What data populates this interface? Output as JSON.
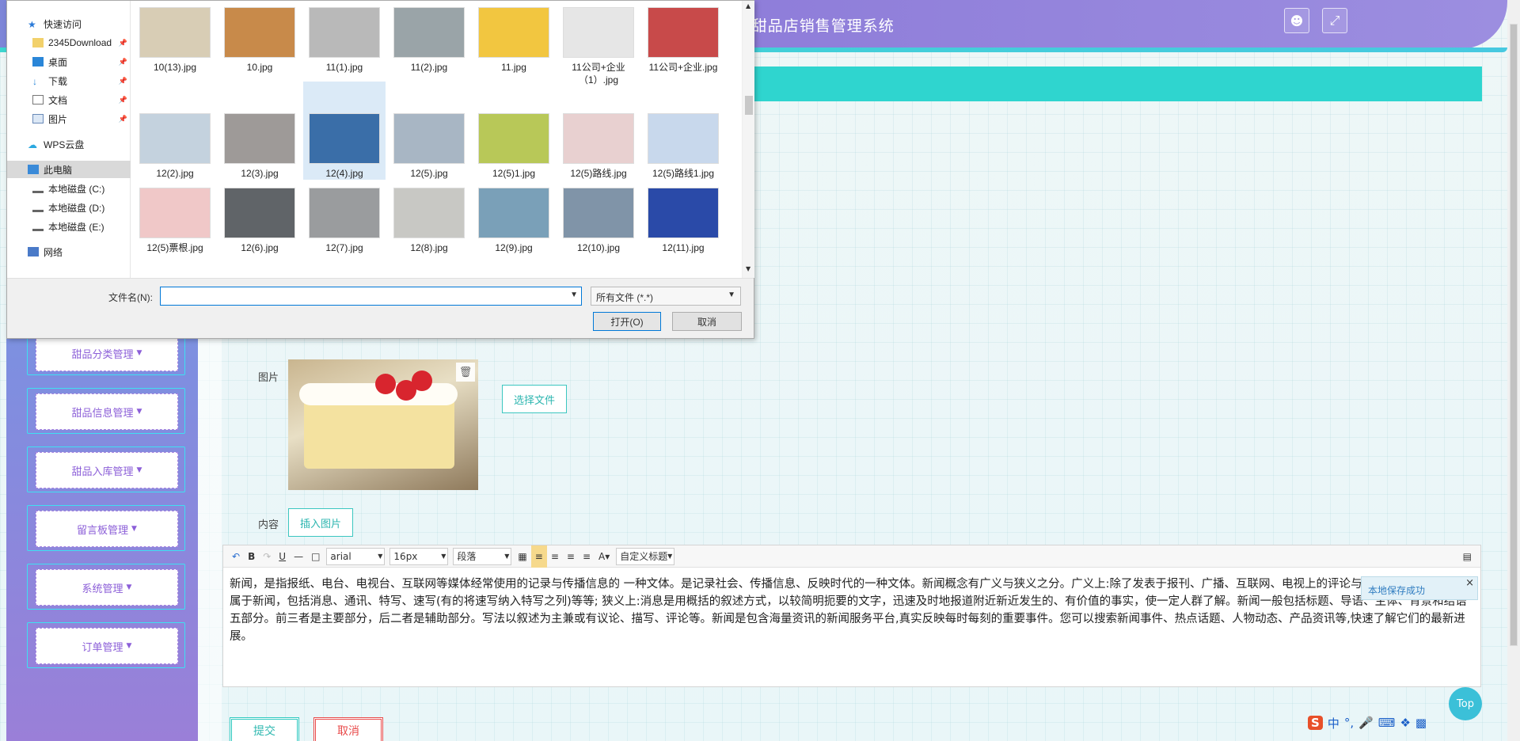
{
  "header": {
    "title": "\"甜品店销售管理系统",
    "user_icon": "user-icon",
    "fullscreen_icon": "fullscreen-icon"
  },
  "sidebar": {
    "items": [
      {
        "label": "甜品分类管理"
      },
      {
        "label": "甜品信息管理"
      },
      {
        "label": "甜品入库管理"
      },
      {
        "label": "留言板管理"
      },
      {
        "label": "系统管理"
      },
      {
        "label": "订单管理"
      }
    ]
  },
  "form": {
    "image_label": "图片",
    "choose_file_label": "选择文件",
    "content_label": "内容",
    "insert_image_label": "插入图片"
  },
  "editor": {
    "toolbar": {
      "font_family": "arial",
      "font_size": "16px",
      "paragraph": "段落",
      "custom_heading": "自定义标题"
    },
    "content": "新闻，是指报纸、电台、电视台、互联网等媒体经常使用的记录与传播信息的 一种文体。是记录社会、传播信息、反映时代的一种文体。新闻概念有广义与狭义之分。广义上:除了发表于报刊、广播、互联网、电视上的评论与专文外的常用文本都属于新闻，包括消息、通讯、特写、速写(有的将速写纳入特写之列)等等; 狭义上:消息是用概括的叙述方式，以较简明扼要的文字，迅速及时地报道附近新近发生的、有价值的事实，使一定人群了解。新闻一般包括标题、导语、主体、背景和结语五部分。前三者是主要部分，后二者是辅助部分。写法以叙述为主兼或有议论、描写、评论等。新闻是包含海量资讯的新闻服务平台,真实反映每时每刻的重要事件。您可以搜索新闻事件、热点话题、人物动态、产品资讯等,快速了解它们的最新进展。"
  },
  "toast": {
    "message": "本地保存成功",
    "close": "×"
  },
  "buttons": {
    "submit": "提交",
    "cancel": "取消",
    "top": "Top"
  },
  "ime": {
    "mode": "中"
  },
  "dialog": {
    "nav": [
      {
        "label": "快速访问",
        "icon": "star-icon"
      },
      {
        "label": "2345Download",
        "icon": "folder-icon"
      },
      {
        "label": "桌面",
        "icon": "desktop-icon"
      },
      {
        "label": "下载",
        "icon": "download-icon"
      },
      {
        "label": "文档",
        "icon": "document-icon"
      },
      {
        "label": "图片",
        "icon": "picture-icon"
      },
      {
        "label": "WPS云盘",
        "icon": "cloud-icon"
      },
      {
        "label": "此电脑",
        "icon": "computer-icon"
      },
      {
        "label": "本地磁盘 (C:)",
        "icon": "drive-icon"
      },
      {
        "label": "本地磁盘 (D:)",
        "icon": "drive-icon"
      },
      {
        "label": "本地磁盘 (E:)",
        "icon": "drive-icon"
      },
      {
        "label": "网络",
        "icon": "network-icon"
      }
    ],
    "files": [
      {
        "name": "10(13).jpg",
        "color": "#d8cdb5"
      },
      {
        "name": "10.jpg",
        "color": "#c88a4a"
      },
      {
        "name": "11(1).jpg",
        "color": "#b9b9b9"
      },
      {
        "name": "11(2).jpg",
        "color": "#9aa4a8"
      },
      {
        "name": "11.jpg",
        "color": "#f2c640"
      },
      {
        "name": "11公司+企业（1）.jpg",
        "color": "#e6e6e6"
      },
      {
        "name": "11公司+企业.jpg",
        "color": "#c84a4a"
      },
      {
        "name": "12(2).jpg",
        "color": "#c4d2de"
      },
      {
        "name": "12(3).jpg",
        "color": "#9e9a98"
      },
      {
        "name": "12(4).jpg",
        "color": "#3a6ea8"
      },
      {
        "name": "12(5).jpg",
        "color": "#a8b6c4"
      },
      {
        "name": "12(5)1.jpg",
        "color": "#b8c858"
      },
      {
        "name": "12(5)路线.jpg",
        "color": "#e8d0d0"
      },
      {
        "name": "12(5)路线1.jpg",
        "color": "#c8d8ec"
      },
      {
        "name": "12(5)票根.jpg",
        "color": "#f0c8c8"
      },
      {
        "name": "12(6).jpg",
        "color": "#606468"
      },
      {
        "name": "12(7).jpg",
        "color": "#9a9c9e"
      },
      {
        "name": "12(8).jpg",
        "color": "#c8c8c4"
      },
      {
        "name": "12(9).jpg",
        "color": "#7aa0b8"
      },
      {
        "name": "12(10).jpg",
        "color": "#8094a8"
      },
      {
        "name": "12(11).jpg",
        "color": "#2a4aa8"
      }
    ],
    "filename_label": "文件名(N):",
    "filename_value": "",
    "filter": "所有文件 (*.*)",
    "open_label": "打开(O)",
    "cancel_label": "取消"
  }
}
